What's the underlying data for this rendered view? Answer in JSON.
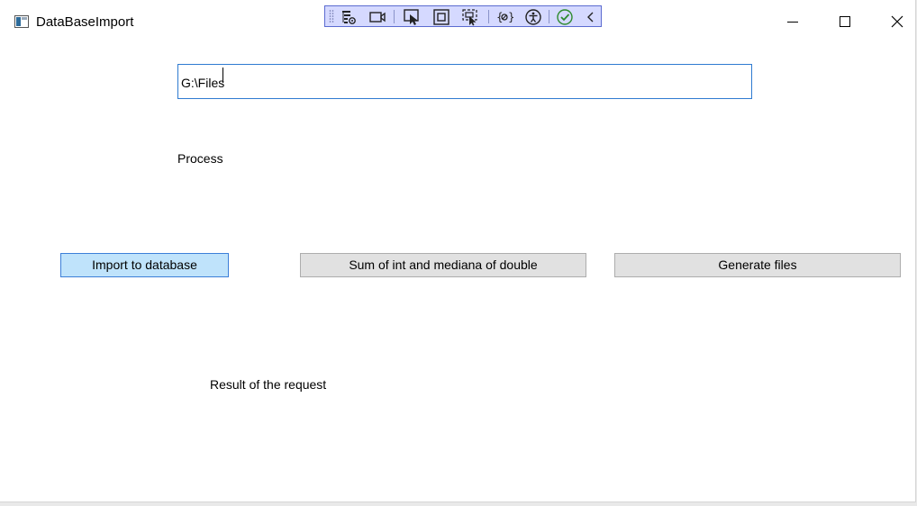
{
  "window": {
    "title": "DataBaseImport",
    "controls": {
      "minimize": "minimize-icon",
      "maximize": "maximize-icon",
      "close": "close-icon"
    }
  },
  "devtoolbar": {
    "tools": [
      "app-tree-icon",
      "video-icon",
      "select-element-icon",
      "layout-adorner-icon",
      "track-focus-icon",
      "binding-failures-icon",
      "accessibility-icon",
      "hot-reload-check-icon",
      "collapse-chevron-icon"
    ]
  },
  "path_input": {
    "value": "G:\\Files"
  },
  "labels": {
    "process": "Process",
    "result": "Result of the request"
  },
  "buttons": {
    "import": "Import to database",
    "sum_median": "Sum of int and mediana of double",
    "generate": "Generate files"
  },
  "colors": {
    "focused_button": "#bfe3fb",
    "devbar": "#d5d9ff",
    "input_border": "#2f7bd1"
  }
}
